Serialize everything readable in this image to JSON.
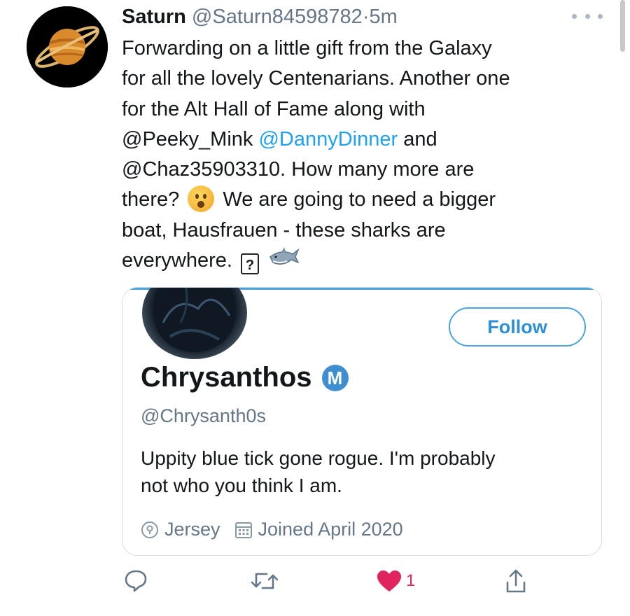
{
  "tweet": {
    "author_name": "Saturn",
    "author_handle": "@Saturn84598782",
    "separator": "·",
    "time": "5m",
    "avatar_icon": "saturn-planet-icon",
    "text_lines": [
      "Forwarding on a little gift from the Galaxy",
      "for all the lovely Centenarians. Another one",
      "for the Alt Hall of Fame along with",
      "@Peeky_Mink",
      "@DannyDinner",
      "and",
      "@Chaz35903310. How many more are",
      "there?",
      "We are going to need a bigger",
      "boat, Hausfrauen - these sharks are",
      "everywhere.",
      "?"
    ],
    "link_color": "#1da1f2"
  },
  "card": {
    "follow_label": "Follow",
    "display_name": "Chrysanthos",
    "badge_letter": "M",
    "handle": "@Chrysanth0s",
    "bio_lines": [
      "Uppity blue tick gone rogue. I'm probably",
      "not who you think I am."
    ],
    "location": "Jersey",
    "joined": "Joined April 2020",
    "accent_color": "#4aa3df"
  },
  "actions": {
    "reply_icon": "reply-icon",
    "retweet_icon": "retweet-icon",
    "like_icon": "heart-icon",
    "like_count": "1",
    "share_icon": "share-icon",
    "like_color": "#e0245e"
  }
}
